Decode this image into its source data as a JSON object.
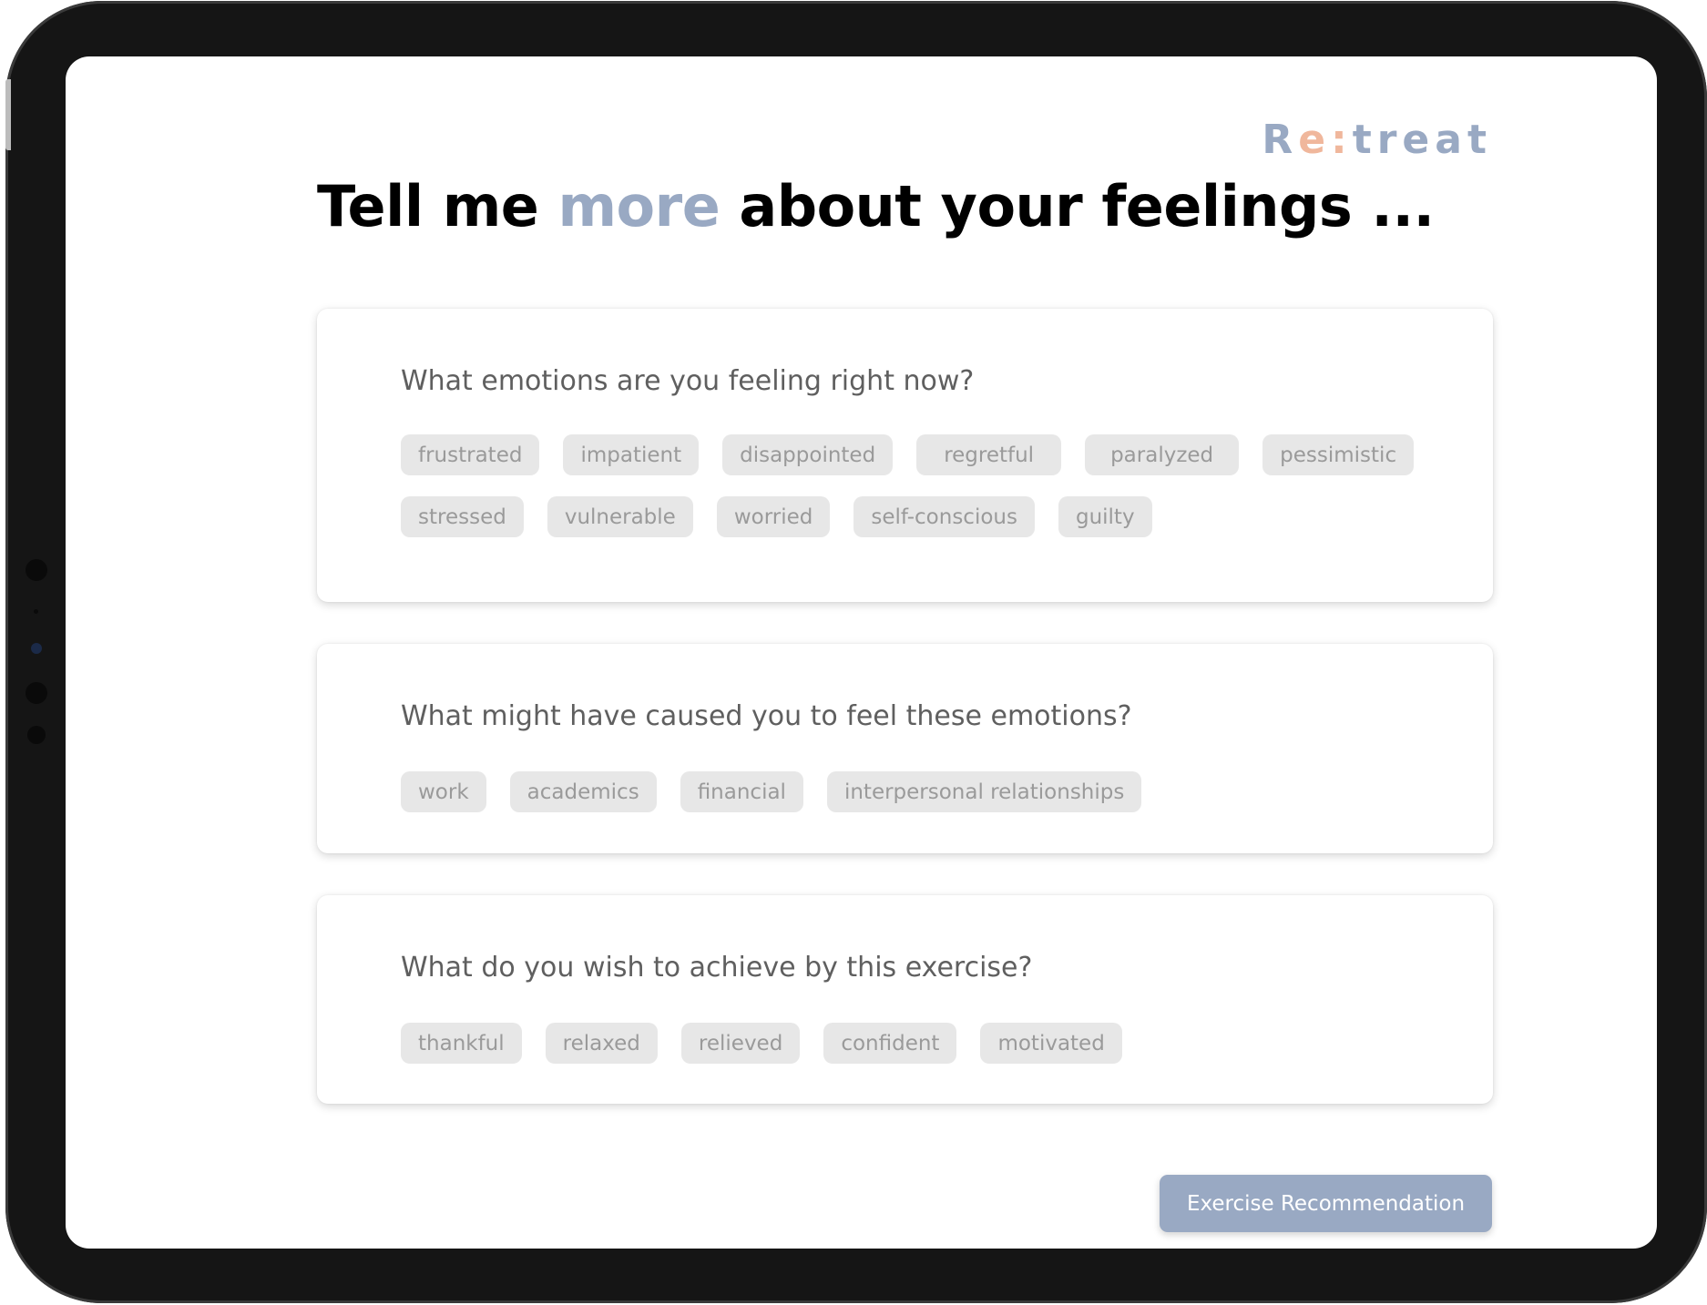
{
  "app": {
    "logo_text_start": "R",
    "logo_text_accent": "e:",
    "logo_text_end": "treat",
    "brand_color": "#99a9c3",
    "accent_color": "#f0b79c"
  },
  "header": {
    "title_part1": "Tell me ",
    "title_highlight": "more",
    "title_part2": " about your feelings ..."
  },
  "questions": [
    {
      "text": "What emotions are you feeling right now?",
      "options": [
        "frustrated",
        "impatient",
        "disappointed",
        "regretful",
        "paralyzed",
        "pessimistic",
        "stressed",
        "vulnerable",
        "worried",
        "self-conscious",
        "guilty"
      ]
    },
    {
      "text": "What might have caused you to feel these emotions?",
      "options": [
        "work",
        "academics",
        "financial",
        "interpersonal relationships"
      ]
    },
    {
      "text": "What do you wish to achieve by this exercise?",
      "options": [
        "thankful",
        "relaxed",
        "relieved",
        "confident",
        "motivated"
      ]
    }
  ],
  "footer": {
    "button_label": "Exercise Recommendation"
  }
}
